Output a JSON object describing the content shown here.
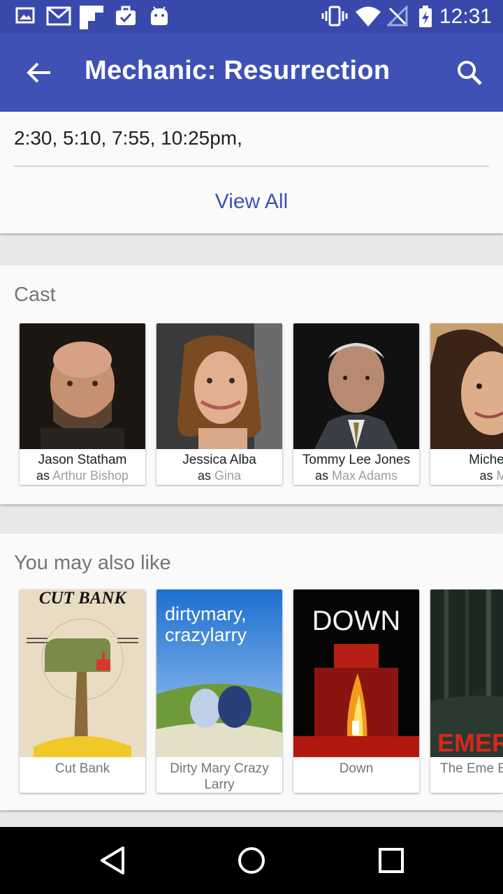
{
  "status_bar": {
    "time": "12:31",
    "left_icons": [
      "image-icon",
      "gmail-icon",
      "flipboard-icon",
      "briefcase-check-icon",
      "android-icon"
    ],
    "right_icons": [
      "vibrate-icon",
      "wifi-icon",
      "no-signal-icon",
      "battery-charging-icon"
    ]
  },
  "app_bar": {
    "title": "Mechanic: Resurrection",
    "back_icon": "arrow-back-icon",
    "search_icon": "search-icon",
    "color": "#3f51b5"
  },
  "showtimes": {
    "times": "2:30, 5:10, 7:55, 10:25pm,",
    "view_all_label": "View All"
  },
  "cast": {
    "title": "Cast",
    "items": [
      {
        "name": "Jason Statham",
        "as": "as",
        "role": "Arthur Bishop"
      },
      {
        "name": "Jessica Alba",
        "as": "as",
        "role": "Gina"
      },
      {
        "name": "Tommy Lee Jones",
        "as": "as",
        "role": "Max Adams"
      },
      {
        "name": "Michelle",
        "as": "as",
        "role": "M"
      }
    ]
  },
  "related": {
    "title": "You may also like",
    "items": [
      {
        "title": "Cut Bank",
        "poster_text": "CUT BANK"
      },
      {
        "title": "Dirty Mary Crazy Larry",
        "poster_text_1": "dirtymary,",
        "poster_text_2": "crazylarry"
      },
      {
        "title": "Down",
        "poster_text": "DOWN"
      },
      {
        "title": "The Eme Experim",
        "poster_text": "EMERY"
      }
    ]
  },
  "nav_bar": {
    "icons": [
      "back-triangle-icon",
      "home-circle-icon",
      "recents-square-icon"
    ]
  }
}
